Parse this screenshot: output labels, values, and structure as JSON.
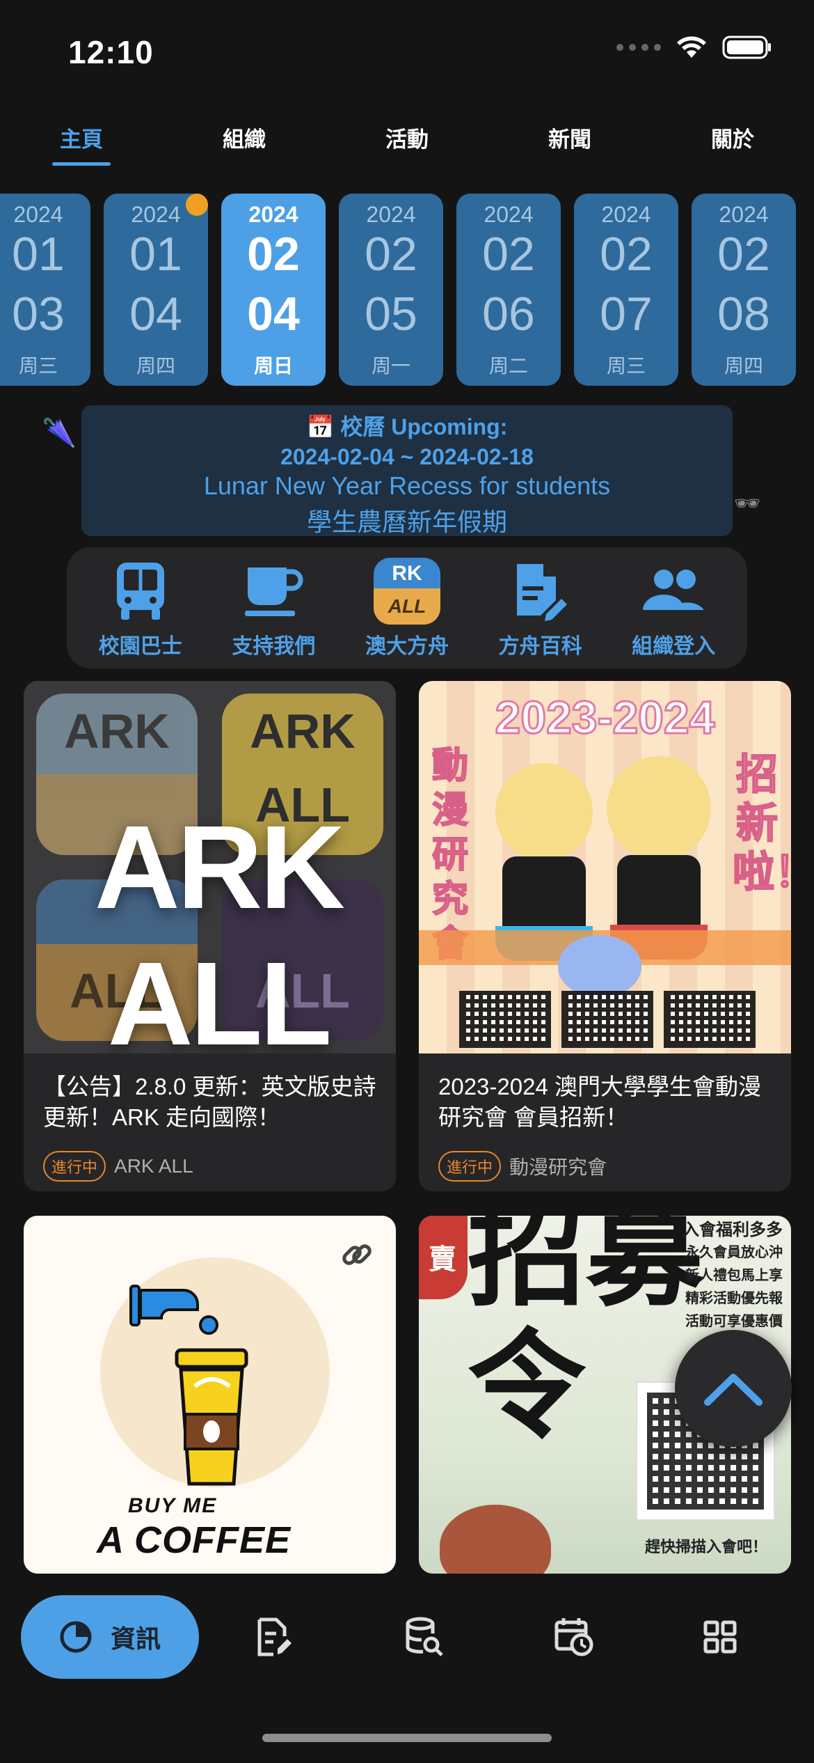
{
  "status_bar": {
    "time": "12:10"
  },
  "top_tabs": [
    {
      "label": "主頁",
      "active": true
    },
    {
      "label": "組織",
      "active": false
    },
    {
      "label": "活動",
      "active": false
    },
    {
      "label": "新聞",
      "active": false
    },
    {
      "label": "關於",
      "active": false
    }
  ],
  "dates": [
    {
      "year": "2024",
      "month": "01",
      "day": "03",
      "weekday": "周三"
    },
    {
      "year": "2024",
      "month": "01",
      "day": "04",
      "weekday": "周四",
      "has_event": true
    },
    {
      "year": "2024",
      "month": "02",
      "day": "04",
      "weekday": "周日",
      "active": true
    },
    {
      "year": "2024",
      "month": "02",
      "day": "05",
      "weekday": "周一"
    },
    {
      "year": "2024",
      "month": "02",
      "day": "06",
      "weekday": "周二"
    },
    {
      "year": "2024",
      "month": "02",
      "day": "07",
      "weekday": "周三"
    },
    {
      "year": "2024",
      "month": "02",
      "day": "08",
      "weekday": "周四"
    }
  ],
  "upcoming": {
    "icon": "📅",
    "heading": "校曆 Upcoming:",
    "range": "2024-02-04 ~ 2024-02-18",
    "title_en": "Lunar New Year Recess for students",
    "title_zh": "學生農曆新年假期",
    "left_emoji": "🌂",
    "right_emoji": "🕶"
  },
  "quick_actions": [
    {
      "label": "校園巴士",
      "icon": "bus-icon"
    },
    {
      "label": "支持我們",
      "icon": "coffee-cup-icon"
    },
    {
      "label": "澳大方舟",
      "icon": "ark-all-app-icon",
      "icon_text_top": "RK",
      "icon_text_bottom": "ALL"
    },
    {
      "label": "方舟百科",
      "icon": "wiki-edit-icon"
    },
    {
      "label": "組織登入",
      "icon": "group-users-icon"
    }
  ],
  "cards": [
    {
      "title": "【公告】2.8.0 更新：英文版史詩更新！ARK 走向國際！",
      "badge": "進行中",
      "org": "ARK ALL",
      "thumb_text": "ARK ALL",
      "tile_labels": [
        "ARK",
        "ALL"
      ]
    },
    {
      "title": "2023-2024 澳門大學學生會動漫研究會 會員招新！",
      "badge": "進行中",
      "org": "動漫研究會",
      "thumb_text": "2023-2024",
      "side_left": "動漫研究會",
      "side_right": "招新啦！"
    },
    {
      "thumb_text_1": "BUY ME",
      "thumb_text_2": "A COFFEE",
      "link_icon": "link-icon"
    },
    {
      "thumb_title": "招募令",
      "seal_text": "賣",
      "list": [
        "入會福利多多",
        "永久會員放心沖",
        "新人禮包馬上享",
        "精彩活動優先報",
        "活動可享優惠價"
      ],
      "footer": "趕快掃描入會吧！"
    }
  ],
  "bottom_nav": {
    "active_label": "資訊",
    "items": [
      "news-pie-icon",
      "notes-edit-icon",
      "database-search-icon",
      "schedule-clock-icon",
      "grid-apps-icon"
    ]
  },
  "colors": {
    "accent": "#4ea1e8",
    "date_card": "#2e6a9c",
    "date_card_active": "#4da0e6",
    "badge": "#e8862a",
    "background": "#141414",
    "surface": "#262628"
  }
}
